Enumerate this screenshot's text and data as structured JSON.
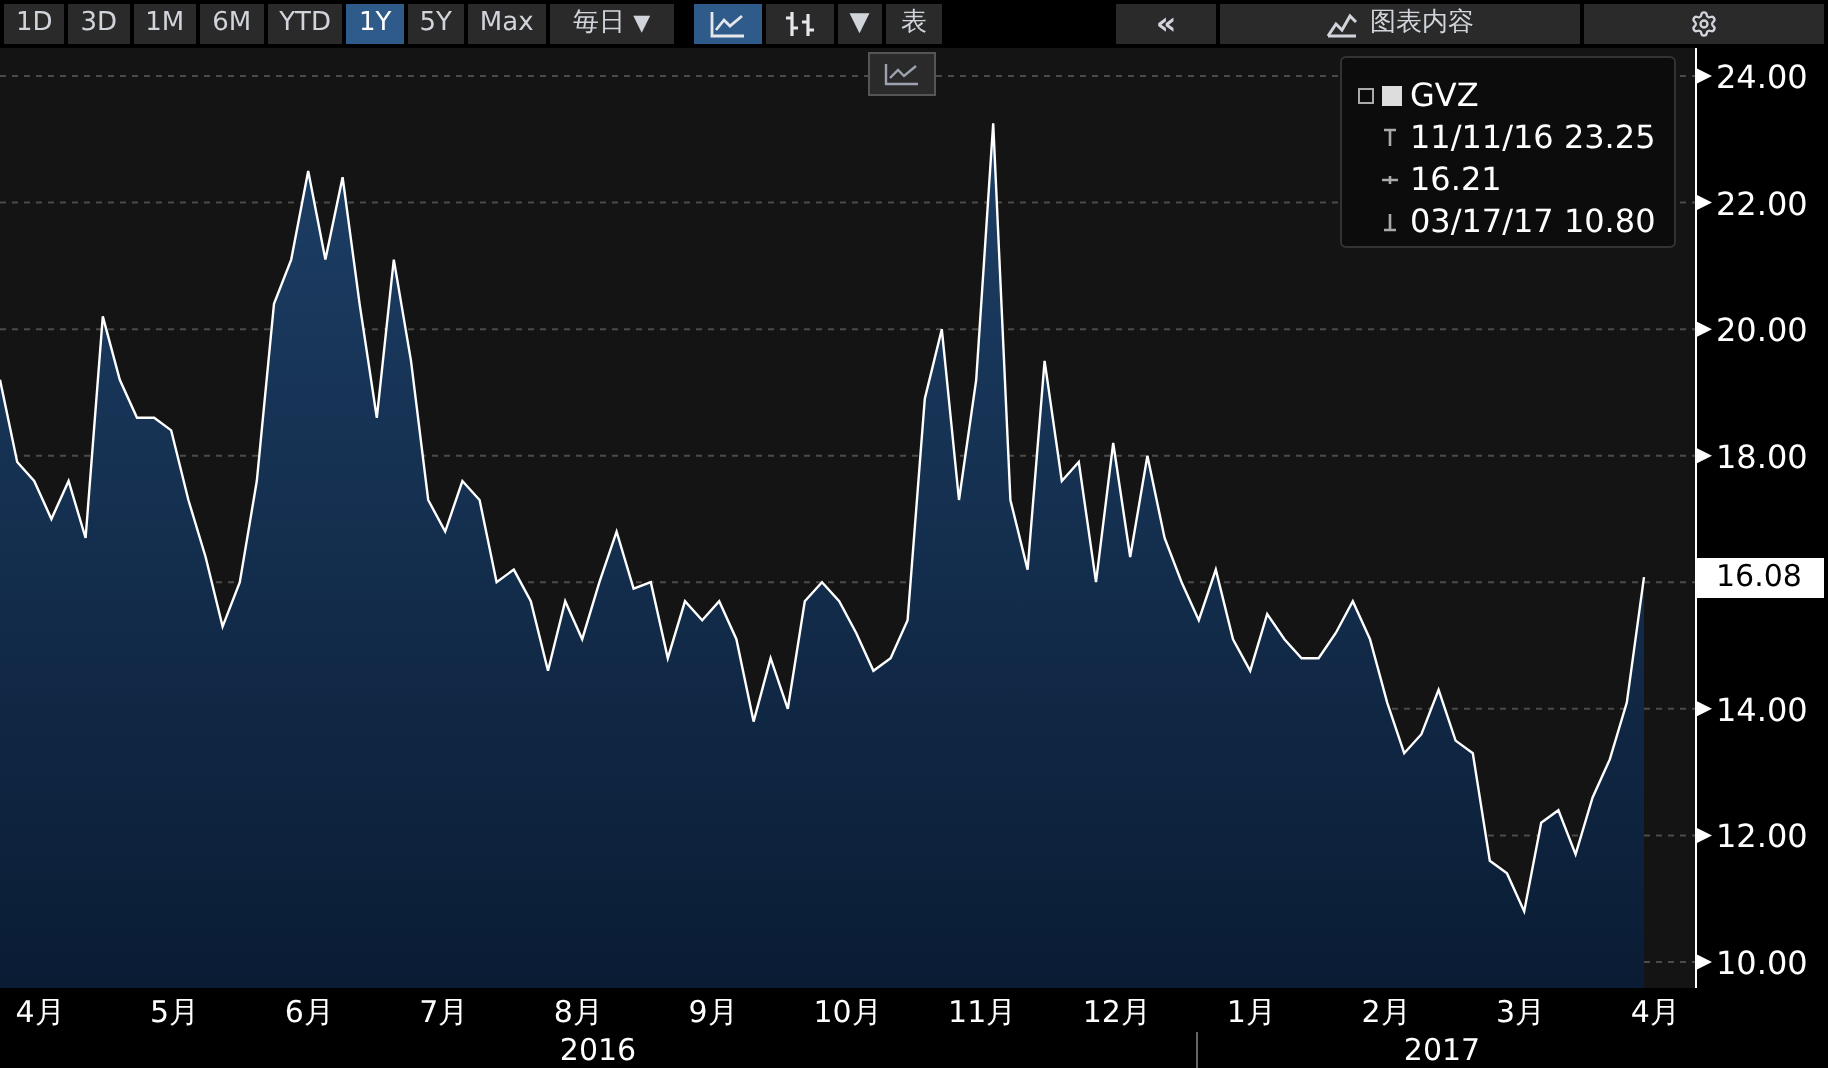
{
  "toolbar": {
    "ranges": [
      {
        "label": "1D",
        "selected": false
      },
      {
        "label": "3D",
        "selected": false
      },
      {
        "label": "1M",
        "selected": false
      },
      {
        "label": "6M",
        "selected": false
      },
      {
        "label": "YTD",
        "selected": false
      },
      {
        "label": "1Y",
        "selected": true
      },
      {
        "label": "5Y",
        "selected": false
      },
      {
        "label": "Max",
        "selected": false
      }
    ],
    "frequency": {
      "label": "毎日",
      "caret": "▼"
    },
    "chart_types": [
      {
        "kind": "line",
        "selected": true
      },
      {
        "kind": "bar",
        "selected": false
      }
    ],
    "dropdown_caret": "▼",
    "table_button": "表",
    "collapse_button": "«",
    "content_button": "图表内容"
  },
  "legend": {
    "high": "11/11/16 23.25",
    "last": "16.21",
    "low": "03/17/17 10.80"
  },
  "last_price": "16.08",
  "chart_data": {
    "type": "area",
    "ylim": [
      10,
      24
    ],
    "grid": true,
    "yticks": [
      {
        "value": 24,
        "label": "24.00"
      },
      {
        "value": 22,
        "label": "22.00"
      },
      {
        "value": 20,
        "label": "20.00"
      },
      {
        "value": 18,
        "label": "18.00"
      },
      {
        "value": 14,
        "label": "14.00"
      },
      {
        "value": 12,
        "label": "12.00"
      },
      {
        "value": 10,
        "label": "10.00"
      }
    ],
    "series": [
      {
        "name": "GVZ",
        "color": "#ffffff",
        "values": [
          19.2,
          17.9,
          17.6,
          17.0,
          17.6,
          16.7,
          20.2,
          19.2,
          18.6,
          18.6,
          18.4,
          17.3,
          16.4,
          15.3,
          16.0,
          17.6,
          20.4,
          21.1,
          22.5,
          21.1,
          22.4,
          20.4,
          18.6,
          21.1,
          19.5,
          17.3,
          16.8,
          17.6,
          17.3,
          16.0,
          16.2,
          15.7,
          14.6,
          15.7,
          15.1,
          16.0,
          16.8,
          15.9,
          16.0,
          14.8,
          15.7,
          15.4,
          15.7,
          15.1,
          13.8,
          14.8,
          14.0,
          15.7,
          16.0,
          15.7,
          15.2,
          14.6,
          14.8,
          15.4,
          18.9,
          20.0,
          17.3,
          19.2,
          23.25,
          17.3,
          16.2,
          19.5,
          17.6,
          17.9,
          16.0,
          18.2,
          16.4,
          18.0,
          16.7,
          16.0,
          15.4,
          16.2,
          15.1,
          14.6,
          15.5,
          15.1,
          14.8,
          14.8,
          15.2,
          15.7,
          15.1,
          14.1,
          13.3,
          13.6,
          14.3,
          13.5,
          13.3,
          11.6,
          11.4,
          10.8,
          12.2,
          12.4,
          11.7,
          12.6,
          13.2,
          14.1,
          16.08
        ]
      }
    ]
  },
  "x_axis": {
    "months": [
      "4月",
      "5月",
      "6月",
      "7月",
      "8月",
      "9月",
      "10月",
      "11月",
      "12月",
      "1月",
      "2月",
      "3月",
      "4月"
    ],
    "years": [
      {
        "label": "2016"
      },
      {
        "label": "2017"
      }
    ]
  }
}
